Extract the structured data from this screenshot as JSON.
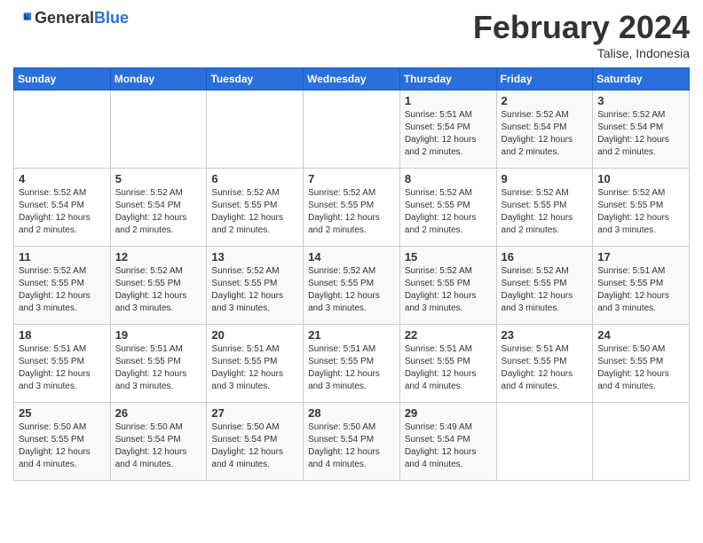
{
  "header": {
    "logo_general": "General",
    "logo_blue": "Blue",
    "month_year": "February 2024",
    "location": "Talise, Indonesia"
  },
  "weekdays": [
    "Sunday",
    "Monday",
    "Tuesday",
    "Wednesday",
    "Thursday",
    "Friday",
    "Saturday"
  ],
  "weeks": [
    [
      {
        "day": "",
        "info": ""
      },
      {
        "day": "",
        "info": ""
      },
      {
        "day": "",
        "info": ""
      },
      {
        "day": "",
        "info": ""
      },
      {
        "day": "1",
        "info": "Sunrise: 5:51 AM\nSunset: 5:54 PM\nDaylight: 12 hours\nand 2 minutes."
      },
      {
        "day": "2",
        "info": "Sunrise: 5:52 AM\nSunset: 5:54 PM\nDaylight: 12 hours\nand 2 minutes."
      },
      {
        "day": "3",
        "info": "Sunrise: 5:52 AM\nSunset: 5:54 PM\nDaylight: 12 hours\nand 2 minutes."
      }
    ],
    [
      {
        "day": "4",
        "info": "Sunrise: 5:52 AM\nSunset: 5:54 PM\nDaylight: 12 hours\nand 2 minutes."
      },
      {
        "day": "5",
        "info": "Sunrise: 5:52 AM\nSunset: 5:54 PM\nDaylight: 12 hours\nand 2 minutes."
      },
      {
        "day": "6",
        "info": "Sunrise: 5:52 AM\nSunset: 5:55 PM\nDaylight: 12 hours\nand 2 minutes."
      },
      {
        "day": "7",
        "info": "Sunrise: 5:52 AM\nSunset: 5:55 PM\nDaylight: 12 hours\nand 2 minutes."
      },
      {
        "day": "8",
        "info": "Sunrise: 5:52 AM\nSunset: 5:55 PM\nDaylight: 12 hours\nand 2 minutes."
      },
      {
        "day": "9",
        "info": "Sunrise: 5:52 AM\nSunset: 5:55 PM\nDaylight: 12 hours\nand 2 minutes."
      },
      {
        "day": "10",
        "info": "Sunrise: 5:52 AM\nSunset: 5:55 PM\nDaylight: 12 hours\nand 3 minutes."
      }
    ],
    [
      {
        "day": "11",
        "info": "Sunrise: 5:52 AM\nSunset: 5:55 PM\nDaylight: 12 hours\nand 3 minutes."
      },
      {
        "day": "12",
        "info": "Sunrise: 5:52 AM\nSunset: 5:55 PM\nDaylight: 12 hours\nand 3 minutes."
      },
      {
        "day": "13",
        "info": "Sunrise: 5:52 AM\nSunset: 5:55 PM\nDaylight: 12 hours\nand 3 minutes."
      },
      {
        "day": "14",
        "info": "Sunrise: 5:52 AM\nSunset: 5:55 PM\nDaylight: 12 hours\nand 3 minutes."
      },
      {
        "day": "15",
        "info": "Sunrise: 5:52 AM\nSunset: 5:55 PM\nDaylight: 12 hours\nand 3 minutes."
      },
      {
        "day": "16",
        "info": "Sunrise: 5:52 AM\nSunset: 5:55 PM\nDaylight: 12 hours\nand 3 minutes."
      },
      {
        "day": "17",
        "info": "Sunrise: 5:51 AM\nSunset: 5:55 PM\nDaylight: 12 hours\nand 3 minutes."
      }
    ],
    [
      {
        "day": "18",
        "info": "Sunrise: 5:51 AM\nSunset: 5:55 PM\nDaylight: 12 hours\nand 3 minutes."
      },
      {
        "day": "19",
        "info": "Sunrise: 5:51 AM\nSunset: 5:55 PM\nDaylight: 12 hours\nand 3 minutes."
      },
      {
        "day": "20",
        "info": "Sunrise: 5:51 AM\nSunset: 5:55 PM\nDaylight: 12 hours\nand 3 minutes."
      },
      {
        "day": "21",
        "info": "Sunrise: 5:51 AM\nSunset: 5:55 PM\nDaylight: 12 hours\nand 3 minutes."
      },
      {
        "day": "22",
        "info": "Sunrise: 5:51 AM\nSunset: 5:55 PM\nDaylight: 12 hours\nand 4 minutes."
      },
      {
        "day": "23",
        "info": "Sunrise: 5:51 AM\nSunset: 5:55 PM\nDaylight: 12 hours\nand 4 minutes."
      },
      {
        "day": "24",
        "info": "Sunrise: 5:50 AM\nSunset: 5:55 PM\nDaylight: 12 hours\nand 4 minutes."
      }
    ],
    [
      {
        "day": "25",
        "info": "Sunrise: 5:50 AM\nSunset: 5:55 PM\nDaylight: 12 hours\nand 4 minutes."
      },
      {
        "day": "26",
        "info": "Sunrise: 5:50 AM\nSunset: 5:54 PM\nDaylight: 12 hours\nand 4 minutes."
      },
      {
        "day": "27",
        "info": "Sunrise: 5:50 AM\nSunset: 5:54 PM\nDaylight: 12 hours\nand 4 minutes."
      },
      {
        "day": "28",
        "info": "Sunrise: 5:50 AM\nSunset: 5:54 PM\nDaylight: 12 hours\nand 4 minutes."
      },
      {
        "day": "29",
        "info": "Sunrise: 5:49 AM\nSunset: 5:54 PM\nDaylight: 12 hours\nand 4 minutes."
      },
      {
        "day": "",
        "info": ""
      },
      {
        "day": "",
        "info": ""
      }
    ]
  ]
}
